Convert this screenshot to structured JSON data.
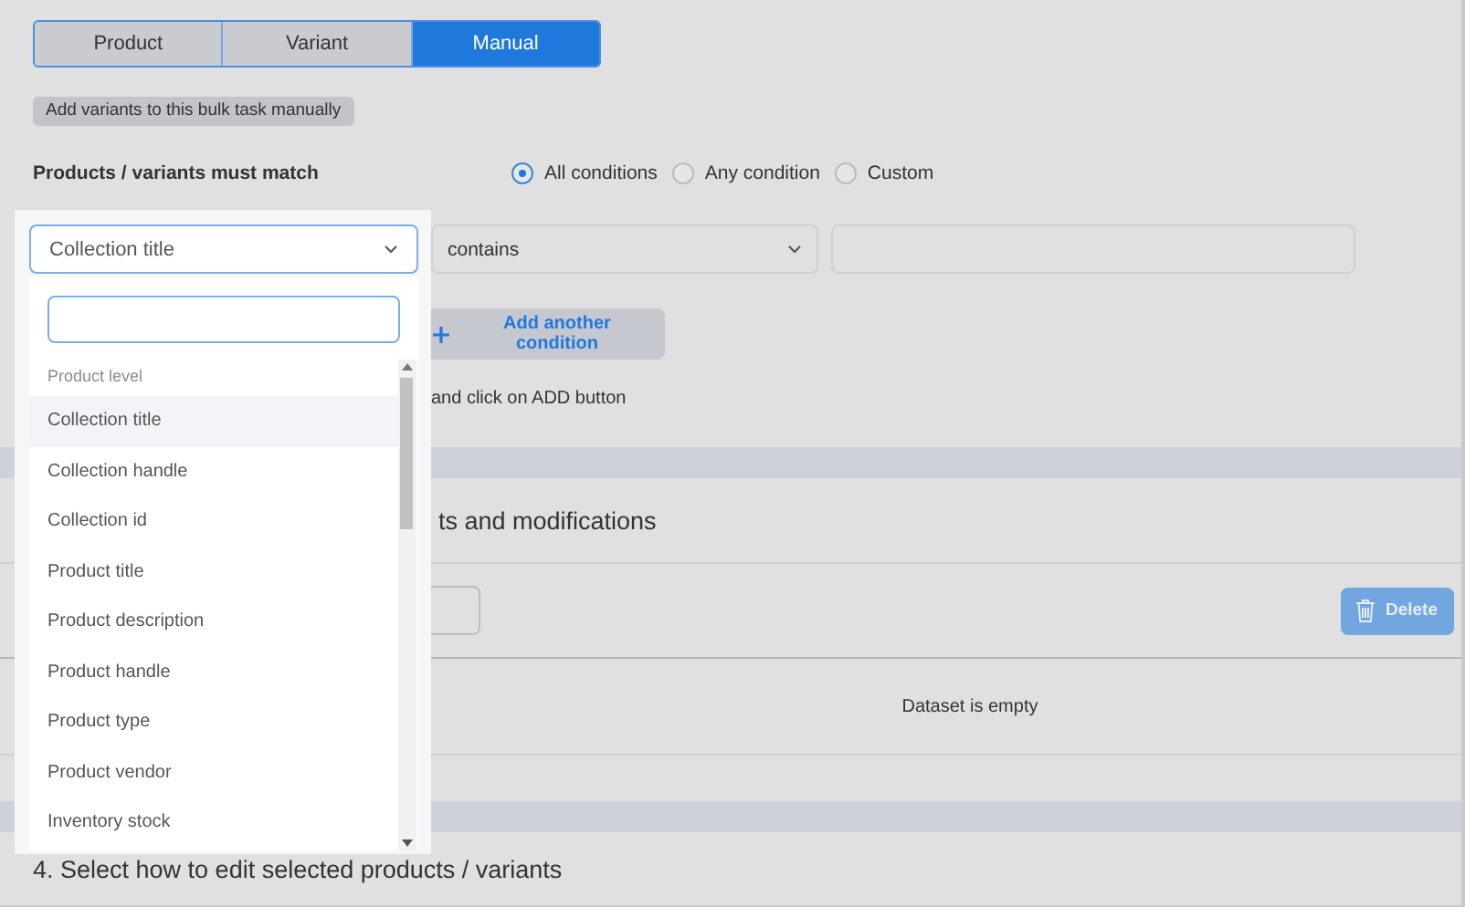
{
  "mode_tabs": [
    {
      "label": "Product",
      "selected": false
    },
    {
      "label": "Variant",
      "selected": false
    },
    {
      "label": "Manual",
      "selected": true
    }
  ],
  "hint_tag": "Add variants to this bulk task manually",
  "match": {
    "label": "Products / variants must match",
    "options": [
      {
        "label": "All conditions",
        "selected": true
      },
      {
        "label": "Any condition",
        "selected": false
      },
      {
        "label": "Custom",
        "selected": false
      }
    ]
  },
  "condition": {
    "field": "Collection title",
    "operator": "contains"
  },
  "add_condition_button": "Add another condition",
  "instruction": "and click on ADD button",
  "section3": {
    "heading": "ts and modifications",
    "delete_button": {
      "label": "Delete",
      "disabled": true
    },
    "empty_message": "Dataset is empty"
  },
  "section4": {
    "heading": "4. Select how to edit selected products / variants"
  },
  "dropdown": {
    "groups": [
      {
        "label": "Product level",
        "items": [
          {
            "label": "Collection title",
            "selected": true
          },
          {
            "label": "Collection handle",
            "selected": false
          },
          {
            "label": "Collection id",
            "selected": false
          },
          {
            "label": "Product title",
            "selected": false
          },
          {
            "label": "Product description",
            "selected": false
          },
          {
            "label": "Product handle",
            "selected": false
          },
          {
            "label": "Product type",
            "selected": false
          },
          {
            "label": "Product vendor",
            "selected": false
          },
          {
            "label": "Inventory stock",
            "selected": false
          }
        ]
      }
    ]
  }
}
